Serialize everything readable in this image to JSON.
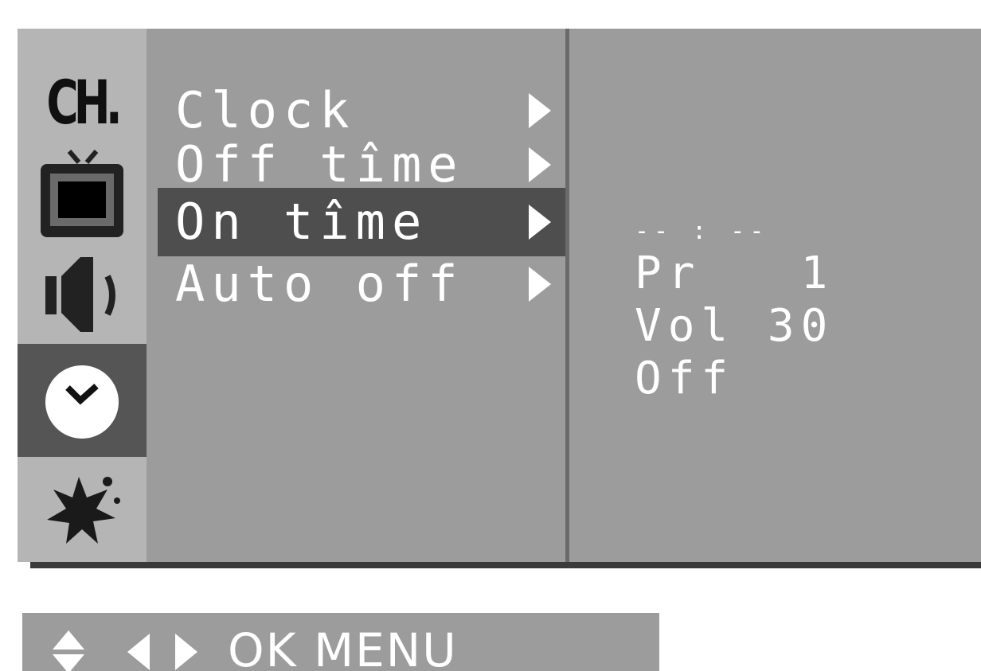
{
  "sidebar": {
    "items": [
      {
        "name": "channel",
        "label": "CH."
      },
      {
        "name": "picture",
        "icon": "tv-icon"
      },
      {
        "name": "sound",
        "icon": "speaker-icon"
      },
      {
        "name": "time",
        "icon": "clock-icon",
        "active": true
      },
      {
        "name": "special",
        "icon": "star-burst-icon"
      }
    ]
  },
  "menu": {
    "items": [
      {
        "label": "Clock"
      },
      {
        "label": "Off tîme"
      },
      {
        "label": "On tîme",
        "selected": true
      },
      {
        "label": "Auto off"
      }
    ]
  },
  "detail": {
    "time": "-- : --",
    "program": "Pr   1",
    "volume": "Vol 30",
    "status": "Off"
  },
  "help_bar": {
    "label": "OK MENU",
    "icons": [
      "up-down-icon",
      "left-right-icon"
    ]
  },
  "colors": {
    "panel": "#9c9c9c",
    "sidebar": "#b5b5b5",
    "selection": "#4e4e4e",
    "text": "#ffffff"
  }
}
